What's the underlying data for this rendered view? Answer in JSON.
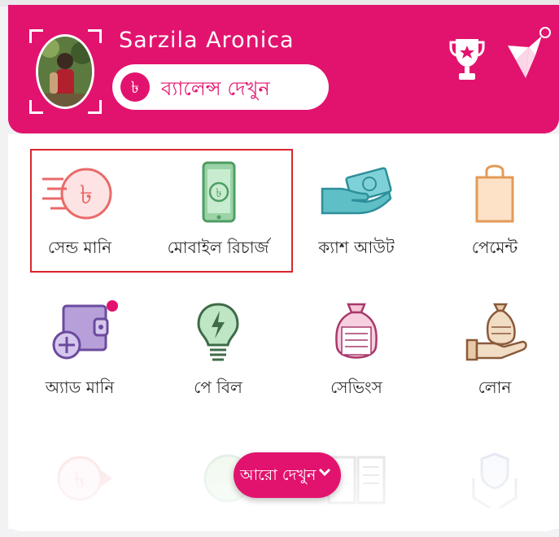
{
  "header": {
    "user_name": "Sarzila  Aronica",
    "balance_button_label": "ব্যালেন্স দেখুন",
    "balance_currency_symbol": "৳",
    "notification_badge": "",
    "brand_color": "#e2136e"
  },
  "services": [
    {
      "label": "সেন্ড মানি",
      "icon": "send-money-icon"
    },
    {
      "label": "মোবাইল রিচার্জ",
      "icon": "mobile-recharge-icon"
    },
    {
      "label": "ক্যাশ আউট",
      "icon": "cash-out-icon"
    },
    {
      "label": "পেমেন্ট",
      "icon": "payment-bag-icon"
    },
    {
      "label": "অ্যাড মানি",
      "icon": "add-money-wallet-icon"
    },
    {
      "label": "পে বিল",
      "icon": "pay-bill-bulb-icon"
    },
    {
      "label": "সেভিংস",
      "icon": "savings-bag-icon"
    },
    {
      "label": "লোন",
      "icon": "loan-hand-icon"
    }
  ],
  "more_button": {
    "label": "আরো দেখুন"
  },
  "highlight_color": "#d9262d"
}
